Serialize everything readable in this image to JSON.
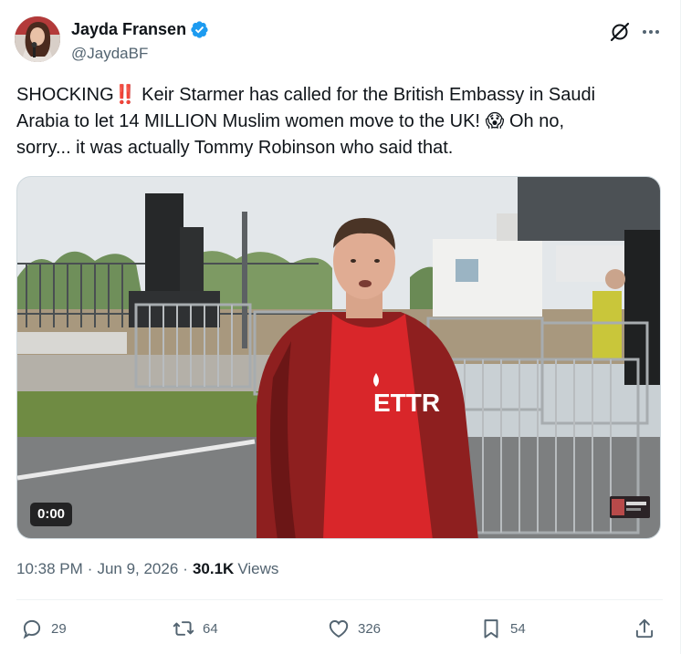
{
  "author": {
    "name": "Jayda Fransen",
    "handle": "@JaydaBF",
    "verified": true
  },
  "tweet": {
    "text_line1": "SHOCKING",
    "text_line1_rest": " Keir Starmer has called for the British Embassy in Saudi",
    "text_line2_start": "Arabia to let 14 MILLION Muslim women move to the UK! ",
    "text_line2_end": " Oh no,",
    "text_line3": "sorry... it was actually Tommy Robinson who said that.",
    "emoji_1": "‼️",
    "emoji_2": "😱"
  },
  "media": {
    "duration": "0:00",
    "shirt_text": "ETTR"
  },
  "meta": {
    "time": "10:38 PM",
    "date": "Jun 9, 2026",
    "views_count": "30.1K",
    "views_label": "Views"
  },
  "actions": {
    "replies": "29",
    "reposts": "64",
    "likes": "326",
    "bookmarks": "54"
  },
  "colors": {
    "text": "#0f1419",
    "secondary": "#536471",
    "verified_blue": "#1d9bf0",
    "shirt_red": "#d9262a",
    "jacket_red": "#8e1f1f"
  },
  "icons": [
    "verified-badge-icon",
    "grok-icon",
    "more-icon",
    "reply-icon",
    "repost-icon",
    "like-icon",
    "bookmark-icon",
    "share-icon"
  ]
}
